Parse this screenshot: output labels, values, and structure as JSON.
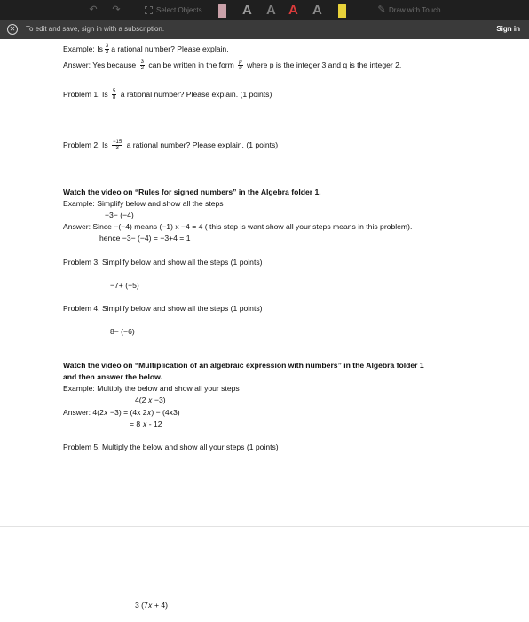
{
  "toolbar": {
    "select_objects": "Select Objects",
    "draw_with_touch": "Draw with Touch",
    "colors": {
      "red": "#d93b3b",
      "yellow": "#e8d23a",
      "pink": "#c9a0a8",
      "grey": "#8a8a8a"
    }
  },
  "banner": {
    "message": "To edit and save, sign in with a subscription.",
    "sign_in": "Sign in"
  },
  "document": {
    "example1": {
      "q_prefix": "Example: Is",
      "q_num": "3",
      "q_den": "2",
      "q_suffix": "a rational number? Please explain.",
      "a_prefix": "Answer: Yes because",
      "a_num": "3",
      "a_den": "2",
      "a_mid": "can be written in the form",
      "a_p": "p",
      "a_q": "q",
      "a_suffix": "where p is the integer 3 and q is the integer 2."
    },
    "problem1": {
      "prefix": "Problem 1. Is",
      "num": "5",
      "den": "8",
      "suffix": "a rational number? Please explain. (1 points)"
    },
    "problem2": {
      "prefix": "Problem 2. Is",
      "num": "−15",
      "den": "3",
      "suffix": "a rational number? Please explain. (1 points)"
    },
    "section2": {
      "heading": "Watch the video on “Rules for signed numbers” in the Algebra folder 1.",
      "example_label": "Example: Simplify below and show all the steps",
      "example_expr": "−3− (−4)",
      "answer_line1": "Answer: Since   −(−4) means (−1) x −4 = 4 ( this step is want show all your steps means in this problem).",
      "answer_line2": "hence  −3− (−4) = −3+4 = 1"
    },
    "problem3": {
      "label": "Problem 3. Simplify below and show all the steps (1 points)",
      "expr": "−7+ (−5)"
    },
    "problem4": {
      "label": "Problem 4. Simplify below and show all the steps (1 points)",
      "expr": "8− (−6)"
    },
    "section3": {
      "heading1": "Watch the video on “Multiplication of an algebraic expression with numbers” in the Algebra folder 1",
      "heading2": "and then answer the below.",
      "example_label": "Example: Multiply the below and show all your steps",
      "example_expr": "4(2 𝑥 −3)",
      "answer_line1": "Answer: 4(2𝑥 −3) = (4x 2𝑥) − (4x3)",
      "answer_line2": "=  8 𝑥  - 12"
    },
    "problem5": {
      "label": "Problem 5. Multiply the below and show all your steps (1 points)",
      "expr": "3 (7𝑥 + 4)"
    }
  }
}
